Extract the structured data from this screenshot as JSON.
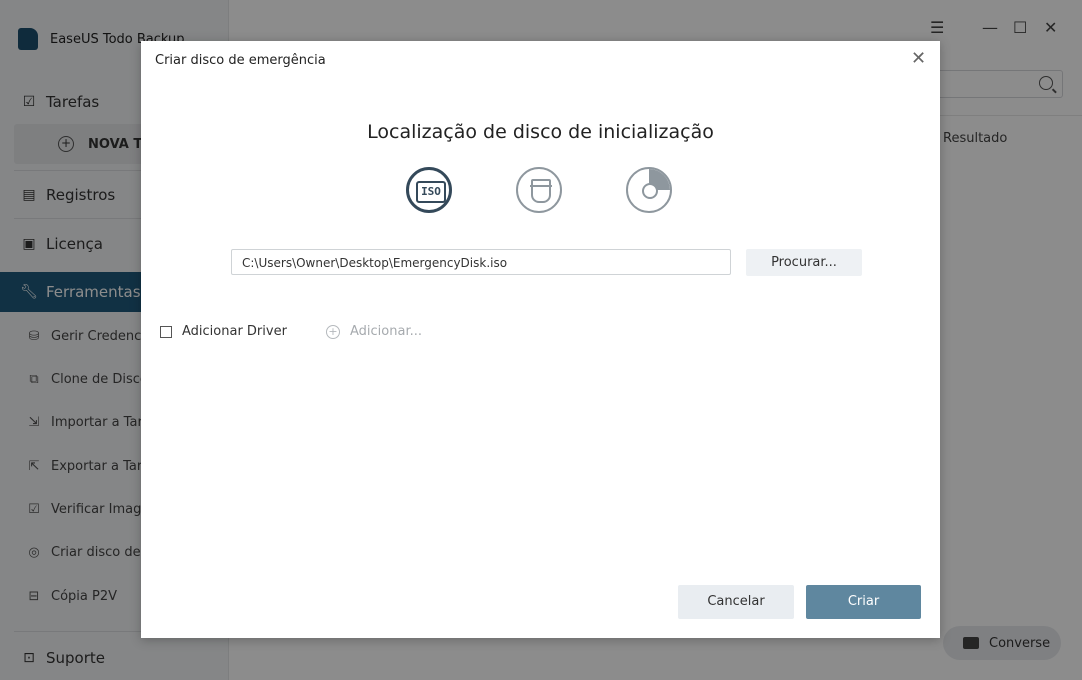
{
  "app": {
    "title": "EaseUS Todo Backup"
  },
  "sidebar": {
    "tasks_label": "Tarefas",
    "new_task_label": "NOVA TA",
    "logs_label": "Registros",
    "license_label": "Licença",
    "tools_label": "Ferramentas",
    "tools": [
      {
        "label": "Gerir Credencia",
        "icon": "credentials-icon"
      },
      {
        "label": "Clone de Disco",
        "icon": "clone-icon"
      },
      {
        "label": "Importar a Tare",
        "icon": "import-icon"
      },
      {
        "label": "Exportar a Taref",
        "icon": "export-icon"
      },
      {
        "label": "Verificar Imagen",
        "icon": "verify-icon"
      },
      {
        "label": "Criar disco de e",
        "icon": "disc-icon"
      },
      {
        "label": "Cópia P2V",
        "icon": "p2v-icon"
      }
    ],
    "support_label": "Suporte"
  },
  "main": {
    "result_column": "Resultado",
    "chat_label": "Converse"
  },
  "dialog": {
    "title": "Criar disco de emergência",
    "heading": "Localização de disco de inicialização",
    "iso_icon_text": "ISO",
    "path_value": "C:\\Users\\Owner\\Desktop\\EmergencyDisk.iso",
    "browse_label": "Procurar...",
    "add_driver_label": "Adicionar Driver",
    "add_driver_checked": false,
    "add_label": "Adicionar...",
    "cancel_label": "Cancelar",
    "create_label": "Criar"
  },
  "colors": {
    "accent": "#1f5a7d",
    "primary_button": "#5f879f"
  }
}
